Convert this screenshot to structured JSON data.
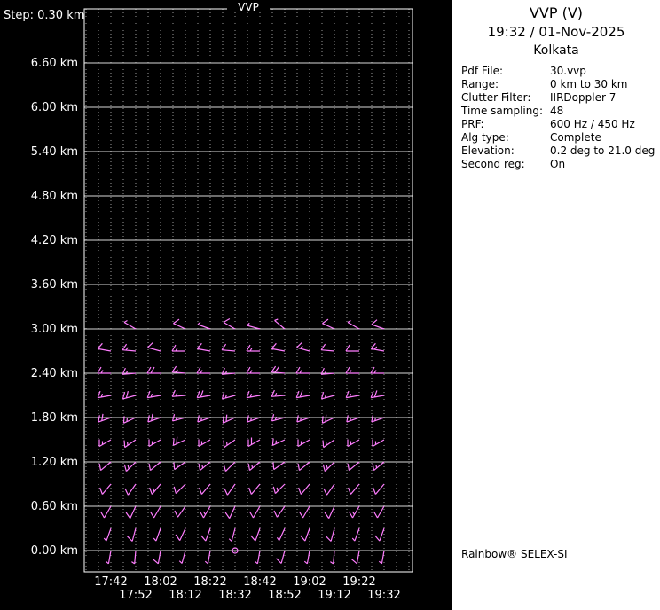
{
  "panel": {
    "title": "VVP (V)",
    "datetime": "19:32 / 01-Nov-2025",
    "site": "Kolkata",
    "fields": [
      {
        "label": "Pdf File:",
        "value": "30.vvp"
      },
      {
        "label": "Range:",
        "value": "0 km to 30 km"
      },
      {
        "label": "Clutter Filter:",
        "value": "IIRDoppler 7"
      },
      {
        "label": "Time sampling:",
        "value": "48"
      },
      {
        "label": "PRF:",
        "value": "600 Hz / 450 Hz"
      },
      {
        "label": "Alg type:",
        "value": "Complete"
      },
      {
        "label": "Elevation:",
        "value": "0.2 deg to 21.0 deg"
      },
      {
        "label": "Second reg:",
        "value": "On"
      }
    ],
    "footer": "Rainbow® SELEX-SI"
  },
  "chart_data": {
    "type": "wind_barb_time_height_profile",
    "title": "VVP",
    "step_label": "Step: 0.30 km",
    "times": [
      "17:42",
      "17:52",
      "18:02",
      "18:12",
      "18:22",
      "18:32",
      "18:42",
      "18:52",
      "19:02",
      "19:12",
      "19:22",
      "19:32"
    ],
    "height_ticks_km": [
      6.6,
      6.0,
      5.4,
      4.8,
      4.2,
      3.6,
      3.0,
      2.4,
      1.8,
      1.2,
      0.6,
      0.0
    ],
    "height_tick_labels": [
      "6.60 km",
      "6.00 km",
      "5.40 km",
      "4.80 km",
      "4.20 km",
      "3.60 km",
      "3.00 km",
      "2.40 km",
      "1.80 km",
      "1.20 km",
      "0.60 km",
      "0.00 km"
    ],
    "height_step_km": 0.3,
    "ylim_km": [
      0.0,
      7.3
    ],
    "barb_units": "knots",
    "grid": "on",
    "colors": {
      "background": "#000000",
      "grid": "#9a9a9a",
      "grid_h": "#d9d9d9",
      "axis": "#ffffff",
      "text": "#ffffff",
      "barb": "#ff7dff",
      "panel_bg": "#ffffff",
      "panel_text": "#000000"
    },
    "barbs": [
      {
        "height_km": 3.0,
        "values": [
          null,
          [
            300,
            5
          ],
          null,
          [
            295,
            10
          ],
          [
            290,
            5
          ],
          [
            300,
            10
          ],
          [
            285,
            5
          ],
          [
            310,
            5
          ],
          null,
          [
            295,
            10
          ],
          [
            300,
            5
          ],
          [
            290,
            10
          ]
        ]
      },
      {
        "height_km": 2.7,
        "values": [
          [
            280,
            10
          ],
          [
            275,
            15
          ],
          [
            285,
            10
          ],
          [
            270,
            15
          ],
          [
            280,
            10
          ],
          [
            275,
            10
          ],
          [
            270,
            15
          ],
          [
            280,
            10
          ],
          [
            285,
            15
          ],
          [
            275,
            10
          ],
          [
            270,
            10
          ],
          [
            280,
            15
          ]
        ]
      },
      {
        "height_km": 2.4,
        "values": [
          [
            270,
            15
          ],
          [
            265,
            15
          ],
          [
            270,
            20
          ],
          [
            275,
            15
          ],
          [
            270,
            15
          ],
          [
            265,
            15
          ],
          [
            270,
            15
          ],
          [
            275,
            20
          ],
          [
            270,
            15
          ],
          [
            265,
            15
          ],
          [
            270,
            15
          ],
          [
            270,
            15
          ]
        ]
      },
      {
        "height_km": 2.1,
        "values": [
          [
            260,
            15
          ],
          [
            255,
            20
          ],
          [
            260,
            15
          ],
          [
            265,
            15
          ],
          [
            260,
            20
          ],
          [
            255,
            15
          ],
          [
            260,
            15
          ],
          [
            265,
            15
          ],
          [
            260,
            20
          ],
          [
            255,
            15
          ],
          [
            260,
            15
          ],
          [
            260,
            20
          ]
        ]
      },
      {
        "height_km": 1.8,
        "values": [
          [
            250,
            20
          ],
          [
            245,
            15
          ],
          [
            250,
            20
          ],
          [
            255,
            15
          ],
          [
            250,
            15
          ],
          [
            245,
            20
          ],
          [
            250,
            15
          ],
          [
            255,
            15
          ],
          [
            250,
            15
          ],
          [
            245,
            20
          ],
          [
            250,
            15
          ],
          [
            250,
            15
          ]
        ]
      },
      {
        "height_km": 1.5,
        "values": [
          [
            240,
            15
          ],
          [
            235,
            15
          ],
          [
            240,
            15
          ],
          [
            245,
            20
          ],
          [
            240,
            15
          ],
          [
            235,
            15
          ],
          [
            240,
            20
          ],
          [
            245,
            15
          ],
          [
            240,
            15
          ],
          [
            235,
            15
          ],
          [
            240,
            15
          ],
          [
            240,
            15
          ]
        ]
      },
      {
        "height_km": 1.2,
        "values": [
          [
            230,
            10
          ],
          [
            225,
            15
          ],
          [
            230,
            10
          ],
          [
            235,
            15
          ],
          [
            230,
            15
          ],
          [
            225,
            10
          ],
          [
            230,
            15
          ],
          [
            235,
            10
          ],
          [
            230,
            10
          ],
          [
            225,
            15
          ],
          [
            230,
            10
          ],
          [
            230,
            15
          ]
        ]
      },
      {
        "height_km": 0.9,
        "values": [
          [
            220,
            10
          ],
          [
            215,
            10
          ],
          [
            220,
            15
          ],
          [
            225,
            10
          ],
          [
            220,
            10
          ],
          [
            215,
            10
          ],
          [
            220,
            10
          ],
          [
            225,
            15
          ],
          [
            220,
            10
          ],
          [
            215,
            10
          ],
          [
            220,
            10
          ],
          [
            220,
            10
          ]
        ]
      },
      {
        "height_km": 0.6,
        "values": [
          [
            210,
            10
          ],
          [
            205,
            10
          ],
          [
            210,
            10
          ],
          [
            215,
            10
          ],
          [
            210,
            15
          ],
          [
            205,
            10
          ],
          [
            210,
            10
          ],
          [
            215,
            10
          ],
          [
            210,
            10
          ],
          [
            205,
            10
          ],
          [
            210,
            15
          ],
          [
            210,
            10
          ]
        ]
      },
      {
        "height_km": 0.3,
        "values": [
          [
            200,
            5
          ],
          [
            195,
            10
          ],
          [
            200,
            5
          ],
          [
            205,
            10
          ],
          [
            200,
            10
          ],
          [
            195,
            5
          ],
          [
            200,
            10
          ],
          [
            205,
            5
          ],
          [
            200,
            10
          ],
          [
            195,
            10
          ],
          [
            200,
            5
          ],
          [
            200,
            10
          ]
        ]
      },
      {
        "height_km": 0.0,
        "values": [
          [
            190,
            5
          ],
          [
            185,
            5
          ],
          [
            190,
            10
          ],
          [
            195,
            5
          ],
          [
            190,
            5
          ],
          [
            0,
            0
          ],
          [
            190,
            5
          ],
          [
            195,
            10
          ],
          [
            190,
            5
          ],
          [
            185,
            5
          ],
          [
            190,
            10
          ],
          [
            190,
            5
          ]
        ]
      }
    ]
  }
}
